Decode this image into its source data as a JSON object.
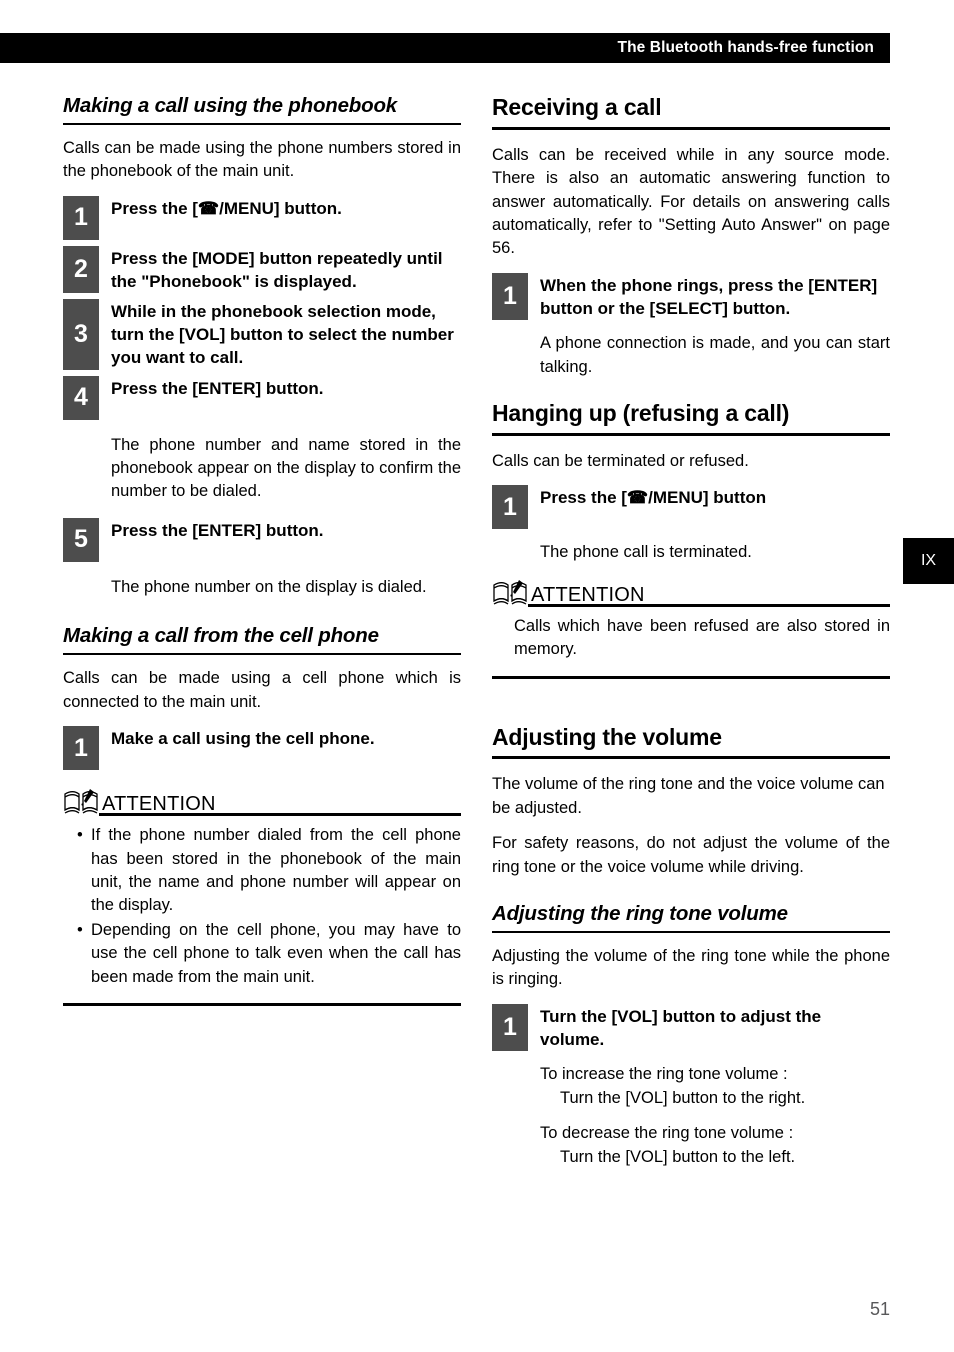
{
  "header": {
    "title": "The Bluetooth hands-free function"
  },
  "chapter_tab": {
    "label": "IX"
  },
  "page_number": "51",
  "icons": {
    "phone": "telephone-icon",
    "book": "open-book-attention-icon"
  },
  "left_column": {
    "section_1": {
      "heading": "Making a call using the phonebook",
      "intro": "Calls can be made using the phone numbers stored in the phonebook of the main unit.",
      "steps": [
        {
          "number": "1",
          "title": "Press the [☎/MENU] button."
        },
        {
          "number": "2",
          "title": "Press the [MODE] button repeatedly until the \"Phonebook\" is displayed."
        },
        {
          "number": "3",
          "title": "While in the phonebook selection mode, turn the [VOL] button to select the number you want to call."
        },
        {
          "number": "4",
          "title": "Press the [ENTER] button.",
          "result": "The phone number and name stored in the phonebook appear on the display to confirm the number to be dialed."
        },
        {
          "number": "5",
          "title": "Press the [ENTER] button.",
          "result": "The phone number on the display is dialed."
        }
      ]
    },
    "section_2": {
      "heading": "Making a call from the cell phone",
      "intro": "Calls can be made using a cell phone which is connected to the main unit.",
      "steps": [
        {
          "number": "1",
          "title": "Make a call using the cell phone."
        }
      ],
      "attention": {
        "label": "ATTENTION",
        "items": [
          "If the phone number dialed from the cell phone has been stored in the phonebook of the main unit, the name and phone number will appear on the display.",
          "Depending on the cell phone, you may have to use the cell phone to talk even when the call has been made from the main unit."
        ]
      }
    }
  },
  "right_column": {
    "section_1": {
      "heading": "Receiving a call",
      "intro": "Calls can be received while in any source mode. There is also an automatic answering function to answer automatically. For details on answering calls automatically, refer to \"Setting Auto Answer\" on page 56.",
      "steps": [
        {
          "number": "1",
          "title": "When the phone rings, press the [ENTER] button or the [SELECT] button.",
          "result": "A phone connection is made, and you can start talking."
        }
      ]
    },
    "section_2": {
      "heading": "Hanging up (refusing a call)",
      "intro": "Calls can be terminated or refused.",
      "steps": [
        {
          "number": "1",
          "title": "Press the [☎/MENU] button",
          "result": "The phone call is terminated."
        }
      ],
      "attention": {
        "label": "ATTENTION",
        "text": "Calls which have been refused are also stored in memory."
      }
    },
    "section_3": {
      "heading": "Adjusting the volume",
      "intro_1": "The volume of the ring tone and the voice volume can be adjusted.",
      "intro_2": "For safety reasons, do not adjust the volume of the ring tone or the voice volume while driving.",
      "subsection": {
        "heading": "Adjusting the ring tone volume",
        "intro": "Adjusting the volume of the ring tone while the phone is ringing.",
        "steps": [
          {
            "number": "1",
            "title": "Turn the [VOL] button to adjust the volume."
          }
        ],
        "notes": [
          {
            "lead": "To increase the ring tone volume :",
            "detail": "Turn the [VOL] button to the right."
          },
          {
            "lead": "To decrease the ring tone volume :",
            "detail": "Turn the [VOL] button to the left."
          }
        ]
      }
    }
  }
}
